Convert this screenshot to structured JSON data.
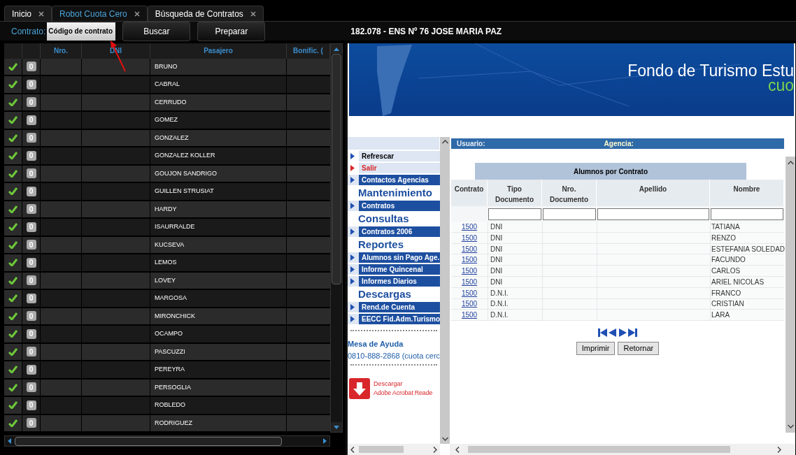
{
  "tabs": [
    {
      "label": "Inicio",
      "selected": false
    },
    {
      "label": "Robot Cuota Cero",
      "selected": true
    },
    {
      "label": "Búsqueda de Contratos",
      "selected": false
    }
  ],
  "toolbar": {
    "label": "Contrato:",
    "field_placeholder": "Código de contrato",
    "buttons": [
      "Buscar",
      "Preparar"
    ],
    "heading": "182.078 - ENS Nº 76 JOSE MARIA PAZ"
  },
  "grid": {
    "columns": [
      "",
      "",
      "Nro.",
      "DNI",
      "Pasajero",
      "Bonific. ("
    ],
    "rows": [
      {
        "checked": true,
        "count": "0",
        "pasajero": "BRUNO"
      },
      {
        "checked": true,
        "count": "0",
        "pasajero": "CABRAL"
      },
      {
        "checked": true,
        "count": "0",
        "pasajero": "CERRUDO"
      },
      {
        "checked": true,
        "count": "0",
        "pasajero": "GOMEZ"
      },
      {
        "checked": true,
        "count": "0",
        "pasajero": "GONZALEZ"
      },
      {
        "checked": true,
        "count": "0",
        "pasajero": "GONZALEZ KOLLER"
      },
      {
        "checked": true,
        "count": "0",
        "pasajero": "GOUJON SANDRIGO"
      },
      {
        "checked": true,
        "count": "0",
        "pasajero": "GUILLEN STRUSIAT"
      },
      {
        "checked": true,
        "count": "0",
        "pasajero": "HARDY"
      },
      {
        "checked": true,
        "count": "0",
        "pasajero": "ISAURRALDE"
      },
      {
        "checked": true,
        "count": "0",
        "pasajero": "KUCSEVA"
      },
      {
        "checked": true,
        "count": "0",
        "pasajero": "LEMOS"
      },
      {
        "checked": true,
        "count": "0",
        "pasajero": "LOVEY"
      },
      {
        "checked": true,
        "count": "0",
        "pasajero": "MARGOSA"
      },
      {
        "checked": true,
        "count": "0",
        "pasajero": "MIRONCHICK"
      },
      {
        "checked": true,
        "count": "0",
        "pasajero": "OCAMPO"
      },
      {
        "checked": true,
        "count": "0",
        "pasajero": "PASCUZZI"
      },
      {
        "checked": true,
        "count": "0",
        "pasajero": "PEREYRA"
      },
      {
        "checked": true,
        "count": "0",
        "pasajero": "PERSOGLIA"
      },
      {
        "checked": true,
        "count": "0",
        "pasajero": "ROBLEDO"
      },
      {
        "checked": true,
        "count": "0",
        "pasajero": "RODRIGUEZ"
      }
    ]
  },
  "web": {
    "banner": {
      "title": "Fondo de Turismo Estu",
      "subtitle": "cuo"
    },
    "sidebar": [
      {
        "kind": "link",
        "label": "Refrescar"
      },
      {
        "kind": "exit",
        "label": "Salir"
      },
      {
        "kind": "item",
        "label": "Contactos Agencias"
      },
      {
        "kind": "heading",
        "label": "Mantenimiento"
      },
      {
        "kind": "item",
        "label": "Contratos"
      },
      {
        "kind": "heading",
        "label": "Consultas"
      },
      {
        "kind": "item",
        "label": "Contratos 2006"
      },
      {
        "kind": "heading",
        "label": "Reportes"
      },
      {
        "kind": "item",
        "label": "Alumnos sin Pago Age."
      },
      {
        "kind": "item",
        "label": "Informe Quincenal"
      },
      {
        "kind": "item",
        "label": "Informes Diarios"
      },
      {
        "kind": "heading",
        "label": "Descargas"
      },
      {
        "kind": "item",
        "label": "Rend.de Cuenta"
      },
      {
        "kind": "item",
        "label": "EECC Fid.Adm.Turismo"
      }
    ],
    "help": {
      "title": "Mesa de Ayuda",
      "phone": "0810-888-2868 (cuota cerc"
    },
    "download": {
      "line1": "Descargar",
      "line2": "Adobe Acrobat Reade"
    },
    "user_bar": {
      "usuario": "Usuario:",
      "agencia": "Agencia:"
    },
    "table": {
      "title": "Alumnos por Contrato",
      "columns": [
        "Contrato",
        "Tipo Documento",
        "Nro. Documento",
        "Apellido",
        "Nombre"
      ],
      "rows": [
        {
          "contrato": "1500",
          "tipo": "DNI",
          "nombre": "TATIANA"
        },
        {
          "contrato": "1500",
          "tipo": "DNI",
          "nombre": "RENZO"
        },
        {
          "contrato": "1500",
          "tipo": "DNI",
          "nombre": "ESTEFANIA SOLEDAD"
        },
        {
          "contrato": "1500",
          "tipo": "DNI",
          "nombre": "FACUNDO"
        },
        {
          "contrato": "1500",
          "tipo": "DNI",
          "nombre": "CARLOS"
        },
        {
          "contrato": "1500",
          "tipo": "DNI",
          "nombre": "ARIEL NICOLAS"
        },
        {
          "contrato": "1500",
          "tipo": "D.N.I.",
          "nombre": "FRANCO"
        },
        {
          "contrato": "1500",
          "tipo": "D.N.I.",
          "nombre": "CRISTIAN"
        },
        {
          "contrato": "1500",
          "tipo": "D.N.I.",
          "nombre": "LARA"
        }
      ]
    },
    "buttons": [
      "Imprimir",
      "Retornar"
    ]
  }
}
